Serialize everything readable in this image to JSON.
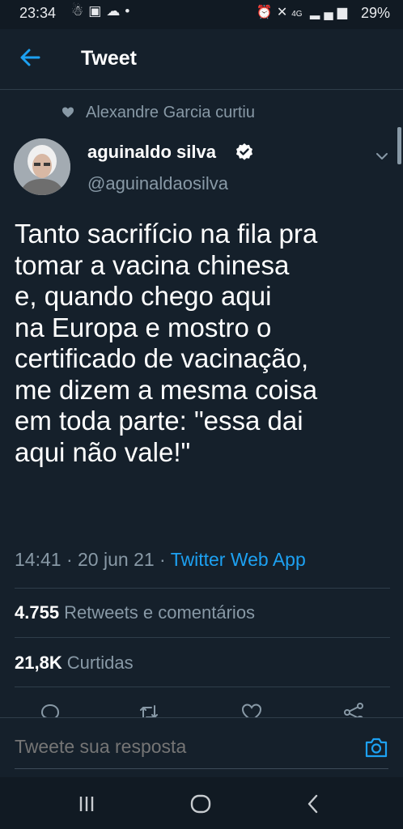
{
  "status_bar": {
    "time": "23:34",
    "notification_icons": [
      "person-icon",
      "gallery-icon",
      "cloud-icon",
      "dot-icon"
    ],
    "system_icons": [
      "alarm-icon",
      "mute-icon",
      "4g-icon",
      "signal-icon"
    ],
    "battery": "29%"
  },
  "header": {
    "back_icon": "arrow-left-icon",
    "title": "Tweet"
  },
  "social_context": "Alexandre Garcia curtiu",
  "author": {
    "name": "aguinaldo silva",
    "handle": "@aguinaldaosilva",
    "verified": true
  },
  "tweet": {
    "text": "Tanto sacrifício na fila pra\ntomar a vacina chinesa\ne, quando chego aqui\nna Europa e mostro o\ncertificado de vacinação,\nme dizem a mesma coisa\nem toda parte: \"essa dai\naqui não vale!\"",
    "time": "14:41",
    "separator": "·",
    "date": "20 jun 21",
    "source": "Twitter Web App"
  },
  "stats": {
    "retweets_count": "4.755",
    "retweets_label": "Retweets e comentários",
    "likes_count": "21,8K",
    "likes_label": "Curtidas"
  },
  "reply": {
    "placeholder": "Tweete sua resposta"
  },
  "colors": {
    "background": "#15202b",
    "accent": "#1da1f2",
    "secondary_text": "#8899a6"
  }
}
